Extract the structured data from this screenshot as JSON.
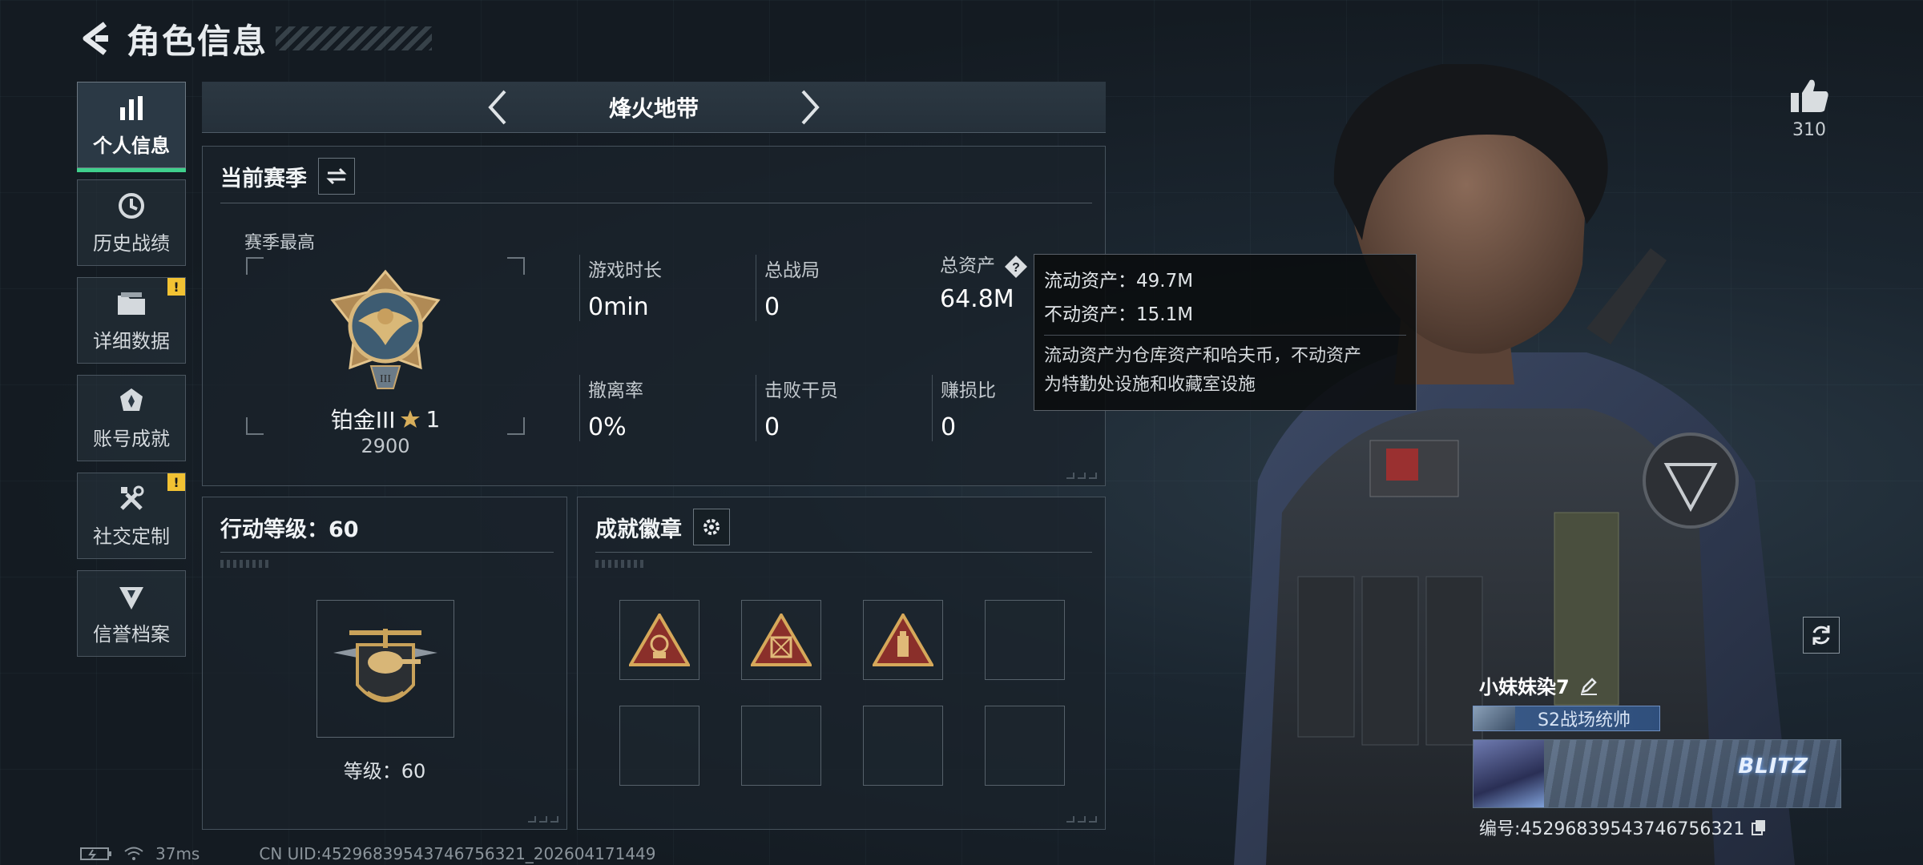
{
  "header": {
    "title": "角色信息"
  },
  "sidebar": {
    "items": [
      {
        "label": "个人信息",
        "icon": "bar-chart-icon",
        "active": true
      },
      {
        "label": "历史战绩",
        "icon": "clock-history-icon",
        "alert": false
      },
      {
        "label": "详细数据",
        "icon": "folder-icon",
        "alert": "!"
      },
      {
        "label": "账号成就",
        "icon": "medal-icon",
        "alert": false
      },
      {
        "label": "社交定制",
        "icon": "tools-icon",
        "alert": "!"
      },
      {
        "label": "信誉档案",
        "icon": "shield-badge-icon",
        "alert": false
      }
    ]
  },
  "mode": {
    "name": "烽火地带"
  },
  "season": {
    "title": "当前赛季",
    "best_label": "赛季最高",
    "rank_name": "铂金III",
    "rank_stars": "1",
    "rank_score": "2900",
    "stats": [
      {
        "label": "游戏时长",
        "value": "0min"
      },
      {
        "label": "总战局",
        "value": "0"
      },
      {
        "label": "总资产",
        "value": "64.8M"
      },
      {
        "label": "撤离率",
        "value": "0%"
      },
      {
        "label": "击败干员",
        "value": "0"
      },
      {
        "label": "赚损比",
        "value": "0"
      }
    ]
  },
  "tooltip": {
    "liquid": "流动资产：49.7M",
    "fixed": "不动资产：15.1M",
    "desc_line1": "流动资产为仓库资产和哈夫币，不动资产",
    "desc_line2": "为特勤处设施和收藏室设施"
  },
  "level": {
    "title": "行动等级：60",
    "text": "等级：60"
  },
  "achievements": {
    "title": "成就徽章",
    "slots": [
      "badge-1",
      "badge-2",
      "badge-3",
      "",
      "",
      "",
      "",
      ""
    ]
  },
  "likes": {
    "count": "310"
  },
  "profile": {
    "name": "小妹妹染7",
    "title": "S2战场统帅",
    "banner_text": "BLITZ",
    "id_line": "编号:45296839543746756321"
  },
  "status": {
    "ping": "37ms",
    "uid": "CN UID:45296839543746756321_202604171449"
  },
  "colors": {
    "accent": "#3fd08c",
    "warn": "#f2c233",
    "gold": "#c9a25a"
  }
}
